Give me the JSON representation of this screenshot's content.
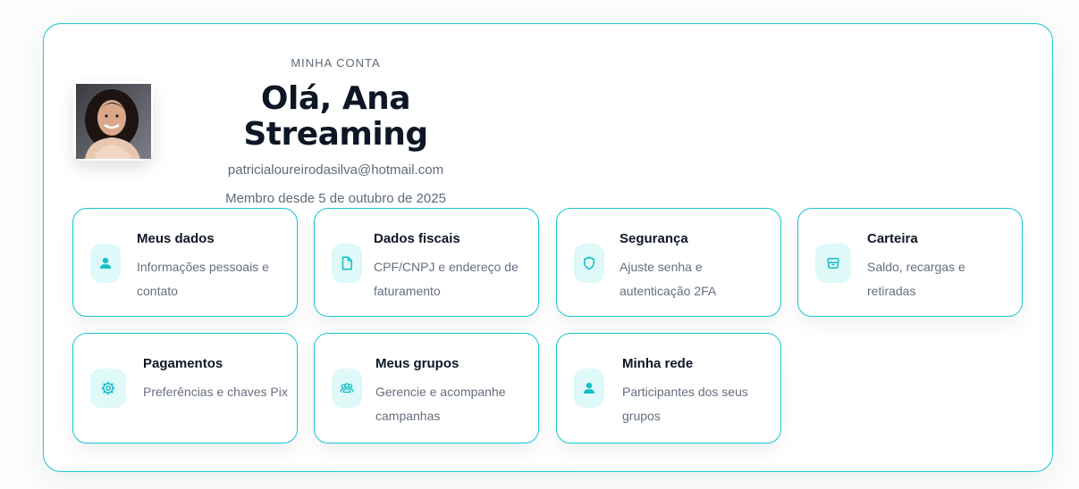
{
  "header": {
    "section_label": "MINHA CONTA",
    "greeting": "Olá, Ana Streaming",
    "email": "patricialoureirodasilva@hotmail.com",
    "member_since": "Membro desde 5 de outubro de 2025"
  },
  "avatar": {
    "icon": "user-photo"
  },
  "colors": {
    "accent": "#19c7cf",
    "icon_bg": "#dff8f8",
    "icon": "#12bfc6",
    "title": "#0d1726",
    "muted": "#65707e"
  },
  "cards": [
    {
      "title": "Meus dados",
      "description": "Informações pessoais e contato",
      "icon": "user-icon"
    },
    {
      "title": "Dados fiscais",
      "description": "CPF/CNPJ e endereço de faturamento",
      "icon": "document-icon"
    },
    {
      "title": "Segurança",
      "description": "Ajuste senha e autenticação 2FA",
      "icon": "shield-icon"
    },
    {
      "title": "Carteira",
      "description": "Saldo, recargas e retiradas",
      "icon": "wallet-icon"
    },
    {
      "title": "Pagamentos",
      "description": "Preferências e chaves Pix",
      "icon": "payment-gear-icon"
    },
    {
      "title": "Meus grupos",
      "description": "Gerencie e acompanhe campanhas",
      "icon": "group-icon"
    },
    {
      "title": "Minha rede",
      "description": "Participantes dos seus grupos",
      "icon": "user-icon"
    }
  ]
}
